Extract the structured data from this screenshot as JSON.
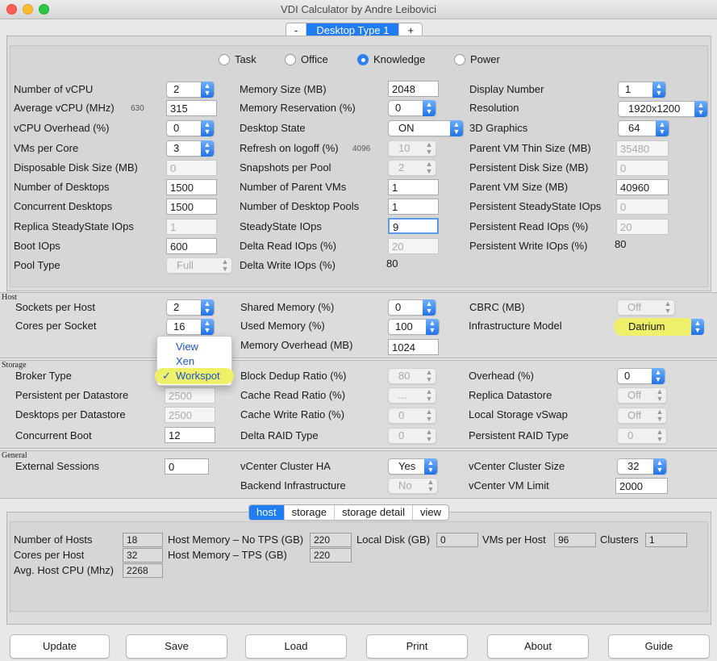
{
  "window": {
    "title": "VDI Calculator by Andre Leibovici"
  },
  "desktop_type": {
    "minus": "-",
    "label": "Desktop Type 1",
    "plus": "+"
  },
  "workload": {
    "options": [
      "Task",
      "Office",
      "Knowledge",
      "Power"
    ],
    "selected": "Knowledge"
  },
  "desktop": {
    "num_vcpu": {
      "label": "Number of vCPU",
      "value": "2"
    },
    "avg_vcpu": {
      "label": "Average vCPU (MHz)",
      "hint": "630",
      "value": "315"
    },
    "vcpu_overhead": {
      "label": "vCPU Overhead (%)",
      "value": "0"
    },
    "vms_per_core": {
      "label": "VMs per Core",
      "value": "3"
    },
    "disposable_disk": {
      "label": "Disposable Disk Size (MB)",
      "value": "0"
    },
    "num_desktops": {
      "label": "Number of Desktops",
      "value": "1500"
    },
    "concurrent_desktops": {
      "label": "Concurrent Desktops",
      "value": "1500"
    },
    "replica_iops": {
      "label": "Replica SteadyState IOps",
      "value": "1"
    },
    "boot_iops": {
      "label": "Boot IOps",
      "value": "600"
    },
    "pool_type": {
      "label": "Pool Type",
      "value": "Full"
    },
    "memory_size": {
      "label": "Memory Size (MB)",
      "value": "2048"
    },
    "memory_reservation": {
      "label": "Memory Reservation (%)",
      "value": "0"
    },
    "desktop_state": {
      "label": "Desktop State",
      "value": "ON"
    },
    "refresh_logoff": {
      "label": "Refresh on logoff (%)",
      "hint": "4096",
      "value": "10"
    },
    "snapshots_per_pool": {
      "label": "Snapshots per Pool",
      "value": "2"
    },
    "num_parent_vms": {
      "label": "Number of Parent VMs",
      "value": "1"
    },
    "num_desktop_pools": {
      "label": "Number of Desktop Pools",
      "value": "1"
    },
    "steadystate_iops": {
      "label": "SteadyState IOps",
      "value": "9"
    },
    "delta_read_iops": {
      "label": "Delta Read IOps (%)",
      "value": "20"
    },
    "delta_write_iops": {
      "label": "Delta Write IOps (%)",
      "value": "80"
    },
    "display_number": {
      "label": "Display Number",
      "value": "1"
    },
    "resolution": {
      "label": "Resolution",
      "value": "1920x1200"
    },
    "graphics_3d": {
      "label": "3D Graphics",
      "value": "64"
    },
    "parent_thin": {
      "label": "Parent VM Thin Size (MB)",
      "value": "35480"
    },
    "persistent_disk": {
      "label": "Persistent Disk Size (MB)",
      "value": "0"
    },
    "parent_vm_size": {
      "label": "Parent VM Size (MB)",
      "value": "40960"
    },
    "persistent_ss_iops": {
      "label": "Persistent SteadyState IOps",
      "value": "0"
    },
    "persistent_read": {
      "label": "Persistent Read IOps (%)",
      "value": "20"
    },
    "persistent_write": {
      "label": "Persistent Write IOps (%)",
      "value": "80"
    }
  },
  "host": {
    "section": "Host",
    "sockets": {
      "label": "Sockets per Host",
      "value": "2"
    },
    "cores": {
      "label": "Cores per Socket",
      "value": "16"
    },
    "shared_memory": {
      "label": "Shared Memory (%)",
      "value": "0"
    },
    "used_memory": {
      "label": "Used Memory (%)",
      "value": "100"
    },
    "memory_overhead": {
      "label": "Memory Overhead (MB)",
      "value": "1024"
    },
    "cbrc": {
      "label": "CBRC (MB)",
      "value": "Off"
    },
    "infra_model": {
      "label": "Infrastructure Model",
      "value": "Datrium"
    }
  },
  "broker_menu": {
    "options": [
      "View",
      "Xen",
      "Workspot"
    ],
    "selected": "Workspot",
    "check": "✓"
  },
  "storage": {
    "section": "Storage",
    "broker_type": {
      "label": "Broker Type"
    },
    "persistent_per_ds": {
      "label": "Persistent per Datastore",
      "value": "2500"
    },
    "desktops_per_ds": {
      "label": "Desktops per Datastore",
      "value": "2500"
    },
    "concurrent_boot": {
      "label": "Concurrent Boot",
      "value": "12"
    },
    "block_dedup": {
      "label": "Block Dedup Ratio (%)",
      "value": "80"
    },
    "cache_read": {
      "label": "Cache Read Ratio (%)",
      "value": "..."
    },
    "cache_write": {
      "label": "Cache Write Ratio (%)",
      "value": "0"
    },
    "delta_raid": {
      "label": "Delta RAID Type",
      "value": "0"
    },
    "overhead": {
      "label": "Overhead (%)",
      "value": "0"
    },
    "replica_ds": {
      "label": "Replica Datastore",
      "value": "Off"
    },
    "local_vswap": {
      "label": "Local Storage vSwap",
      "value": "Off"
    },
    "persistent_raid": {
      "label": "Persistent RAID Type",
      "value": "0"
    }
  },
  "general": {
    "section": "General",
    "external_sessions": {
      "label": "External Sessions",
      "value": "0"
    },
    "vcenter_ha": {
      "label": "vCenter Cluster HA",
      "value": "Yes"
    },
    "backend_infra": {
      "label": "Backend Infrastructure",
      "value": "No"
    },
    "vcenter_cluster_size": {
      "label": "vCenter Cluster Size",
      "value": "32"
    },
    "vcenter_vm_limit": {
      "label": "vCenter VM Limit",
      "value": "2000"
    }
  },
  "results": {
    "tabs": [
      "host",
      "storage",
      "storage detail",
      "view"
    ],
    "active_tab": "host",
    "num_hosts": {
      "label": "Number of Hosts",
      "value": "18"
    },
    "cores_per_host": {
      "label": "Cores per Host",
      "value": "32"
    },
    "avg_host_cpu": {
      "label": "Avg. Host CPU (Mhz)",
      "value": "2268"
    },
    "host_mem_no_tps": {
      "label": "Host Memory – No TPS (GB)",
      "value": "220"
    },
    "host_mem_tps": {
      "label": "Host Memory – TPS (GB)",
      "value": "220"
    },
    "local_disk": {
      "label": "Local Disk (GB)",
      "value": "0"
    },
    "vms_per_host": {
      "label": "VMs per Host",
      "value": "96"
    },
    "clusters": {
      "label": "Clusters",
      "value": "1"
    }
  },
  "buttons": {
    "update": "Update",
    "save": "Save",
    "load": "Load",
    "print": "Print",
    "about": "About",
    "guide": "Guide"
  },
  "colors": {
    "accent": "#1f7cf2",
    "highlight": "#eef06a"
  }
}
